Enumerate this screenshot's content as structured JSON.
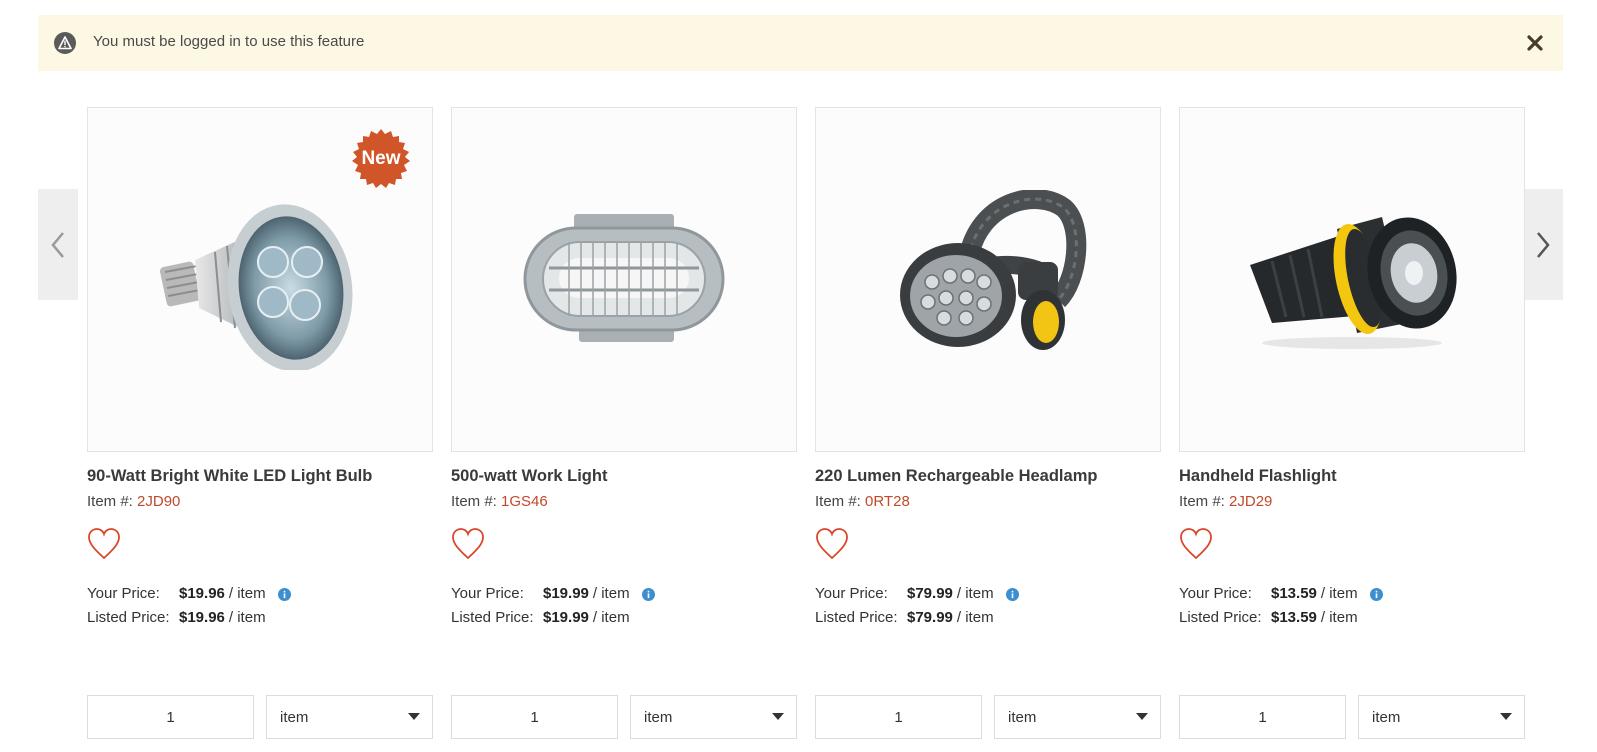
{
  "alert": {
    "message": "You must be logged in to use this feature",
    "icon": "warning-icon",
    "close_icon": "close-icon"
  },
  "carousel": {
    "prev_icon": "chevron-left-icon",
    "next_icon": "chevron-right-icon"
  },
  "labels": {
    "item_prefix": "Item #:",
    "your_price": "Your Price:",
    "listed_price": "Listed Price:",
    "per_unit": "/ item"
  },
  "products": [
    {
      "title": "90-Watt Bright White LED Light Bulb",
      "item_code": "2JD90",
      "badge": "New",
      "your_price": "$19.96",
      "listed_price": "$19.96",
      "quantity": "1",
      "unit": "item",
      "image_icon": "led-bulb-image"
    },
    {
      "title": "500-watt Work Light",
      "item_code": "1GS46",
      "badge": "",
      "your_price": "$19.99",
      "listed_price": "$19.99",
      "quantity": "1",
      "unit": "item",
      "image_icon": "work-light-image"
    },
    {
      "title": "220 Lumen Rechargeable Headlamp",
      "item_code": "0RT28",
      "badge": "",
      "your_price": "$79.99",
      "listed_price": "$79.99",
      "quantity": "1",
      "unit": "item",
      "image_icon": "headlamp-image"
    },
    {
      "title": "Handheld Flashlight",
      "item_code": "2JD29",
      "badge": "",
      "your_price": "$13.59",
      "listed_price": "$13.59",
      "quantity": "1",
      "unit": "item",
      "image_icon": "flashlight-image"
    }
  ],
  "colors": {
    "accent": "#c0492a",
    "badge": "#d0562a",
    "alert_bg": "#fcf8e3",
    "info": "#3d8fcf",
    "heart": "#d9472b"
  }
}
